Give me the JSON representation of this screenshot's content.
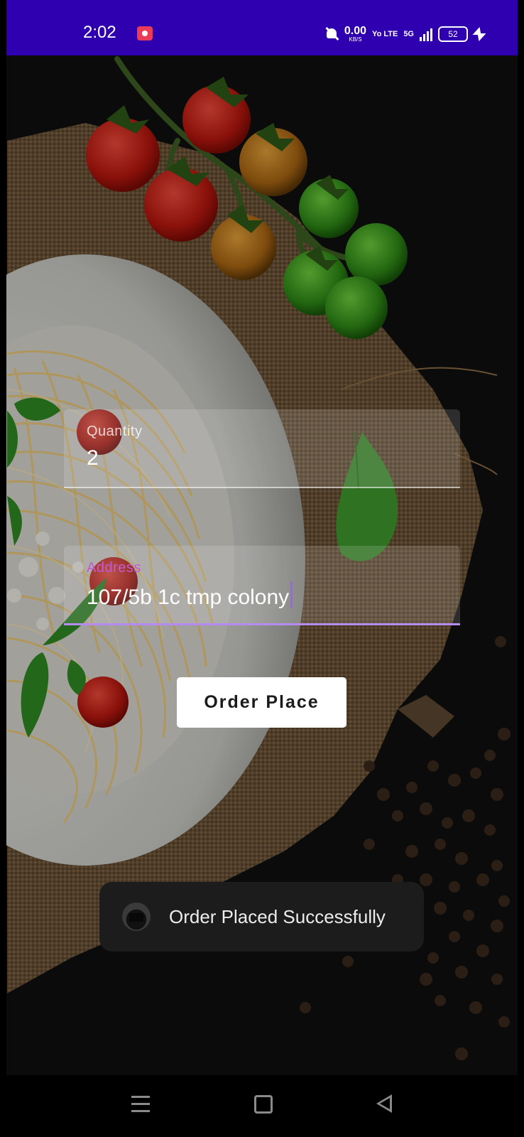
{
  "status_bar": {
    "time": "2:02",
    "network_speed_value": "0.00",
    "network_speed_unit": "KB/S",
    "network_type": "Yo LTE",
    "signal_type": "5G",
    "battery_level": "52",
    "colors": {
      "background": "#2f00b0"
    }
  },
  "form": {
    "quantity": {
      "label": "Quantity",
      "value": "2"
    },
    "address": {
      "label": "Address",
      "value": "107/5b 1c tmp colony"
    },
    "submit_label": "Order Place"
  },
  "toast": {
    "message": "Order Placed Successfully"
  },
  "icons": {
    "status_app": "youtube-icon",
    "dnd": "notifications-off-icon",
    "charging": "bolt-icon",
    "toast": "app-icon",
    "nav_recents": "menu-icon",
    "nav_home": "home-icon",
    "nav_back": "back-icon"
  },
  "colors": {
    "accent": "#b68bf0",
    "focused_label": "#c35ad4"
  }
}
